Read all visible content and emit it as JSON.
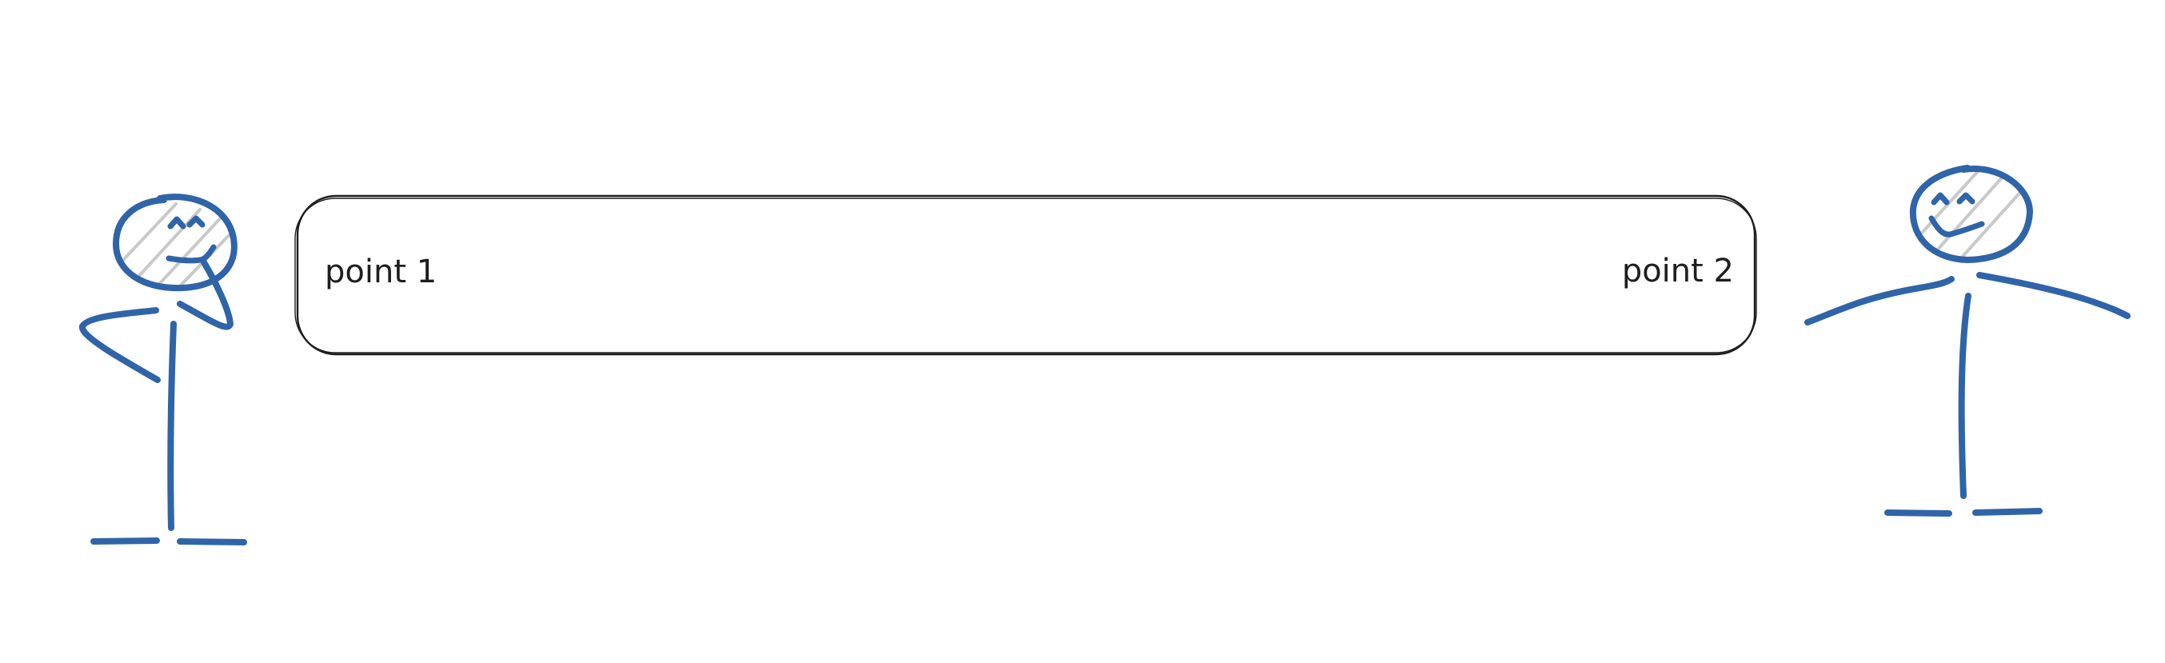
{
  "diagram": {
    "box": {
      "left_label": "point 1",
      "right_label": "point 2"
    },
    "figures": [
      {
        "name": "stick-figure-left",
        "pose": "thinking",
        "icon": "person-thinking-icon"
      },
      {
        "name": "stick-figure-right",
        "pose": "arms-outstretched",
        "icon": "person-arms-out-icon"
      }
    ],
    "colors": {
      "figure_stroke": "#2f64a9",
      "head_hatch": "#c9c9c9",
      "box_stroke": "#1e1e1e",
      "text": "#1e1e1e",
      "background": "#ffffff"
    }
  }
}
